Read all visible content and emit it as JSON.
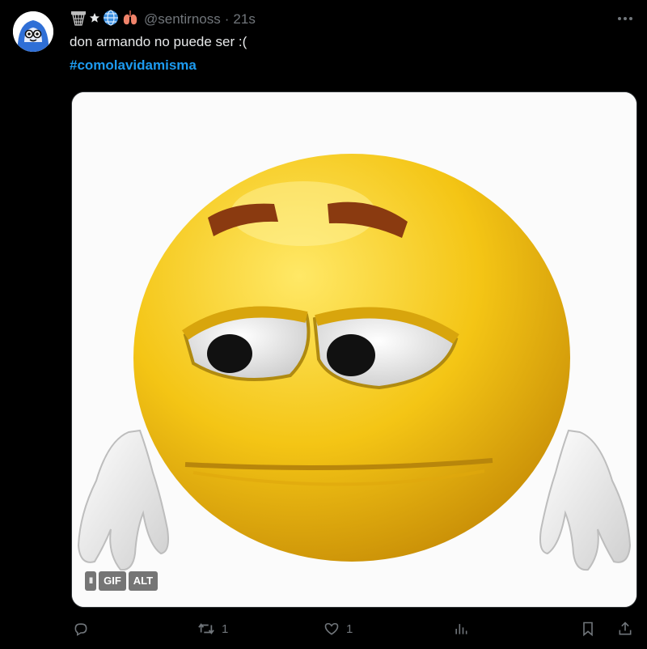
{
  "tweet": {
    "handle": "@sentirnoss",
    "separator": "·",
    "time": "21s",
    "text": "don armando no puede ser :(",
    "hashtag": "#comolavidamisma",
    "badges": [
      "basket-icon",
      "star-icon",
      "globe-icon",
      "lungs-icon"
    ]
  },
  "media": {
    "type_label": "GIF",
    "alt_label": "ALT",
    "pause_label": "II"
  },
  "actions": {
    "reply_count": "",
    "retweet_count": "1",
    "like_count": "1",
    "views_count": ""
  },
  "colors": {
    "background": "#000000",
    "hashtag": "#1d9bf0",
    "muted": "#71767b",
    "emoji_yellow": "#f2c81a"
  }
}
